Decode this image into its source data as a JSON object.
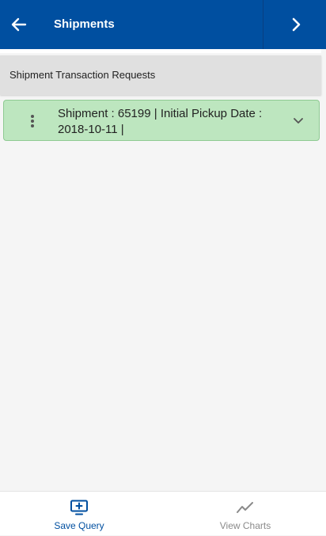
{
  "header": {
    "title": "Shipments",
    "back_icon": "arrow-left-icon",
    "next_icon": "chevron-right-icon",
    "background_color": "#004fa0"
  },
  "section": {
    "title": "Shipment Transaction Requests"
  },
  "records": [
    {
      "text": "Shipment : 65199 | Initial Pickup Date : 2018-10-11 |",
      "menu_icon": "kebab-menu-icon",
      "expand_icon": "chevron-down-icon",
      "background_color": "#bde6bf"
    }
  ],
  "footer": {
    "save_query": {
      "label": "Save Query",
      "icon": "add-to-monitor-icon",
      "color": "#004fa0"
    },
    "view_charts": {
      "label": "View Charts",
      "icon": "line-chart-icon",
      "color": "#8a8a8a"
    }
  }
}
